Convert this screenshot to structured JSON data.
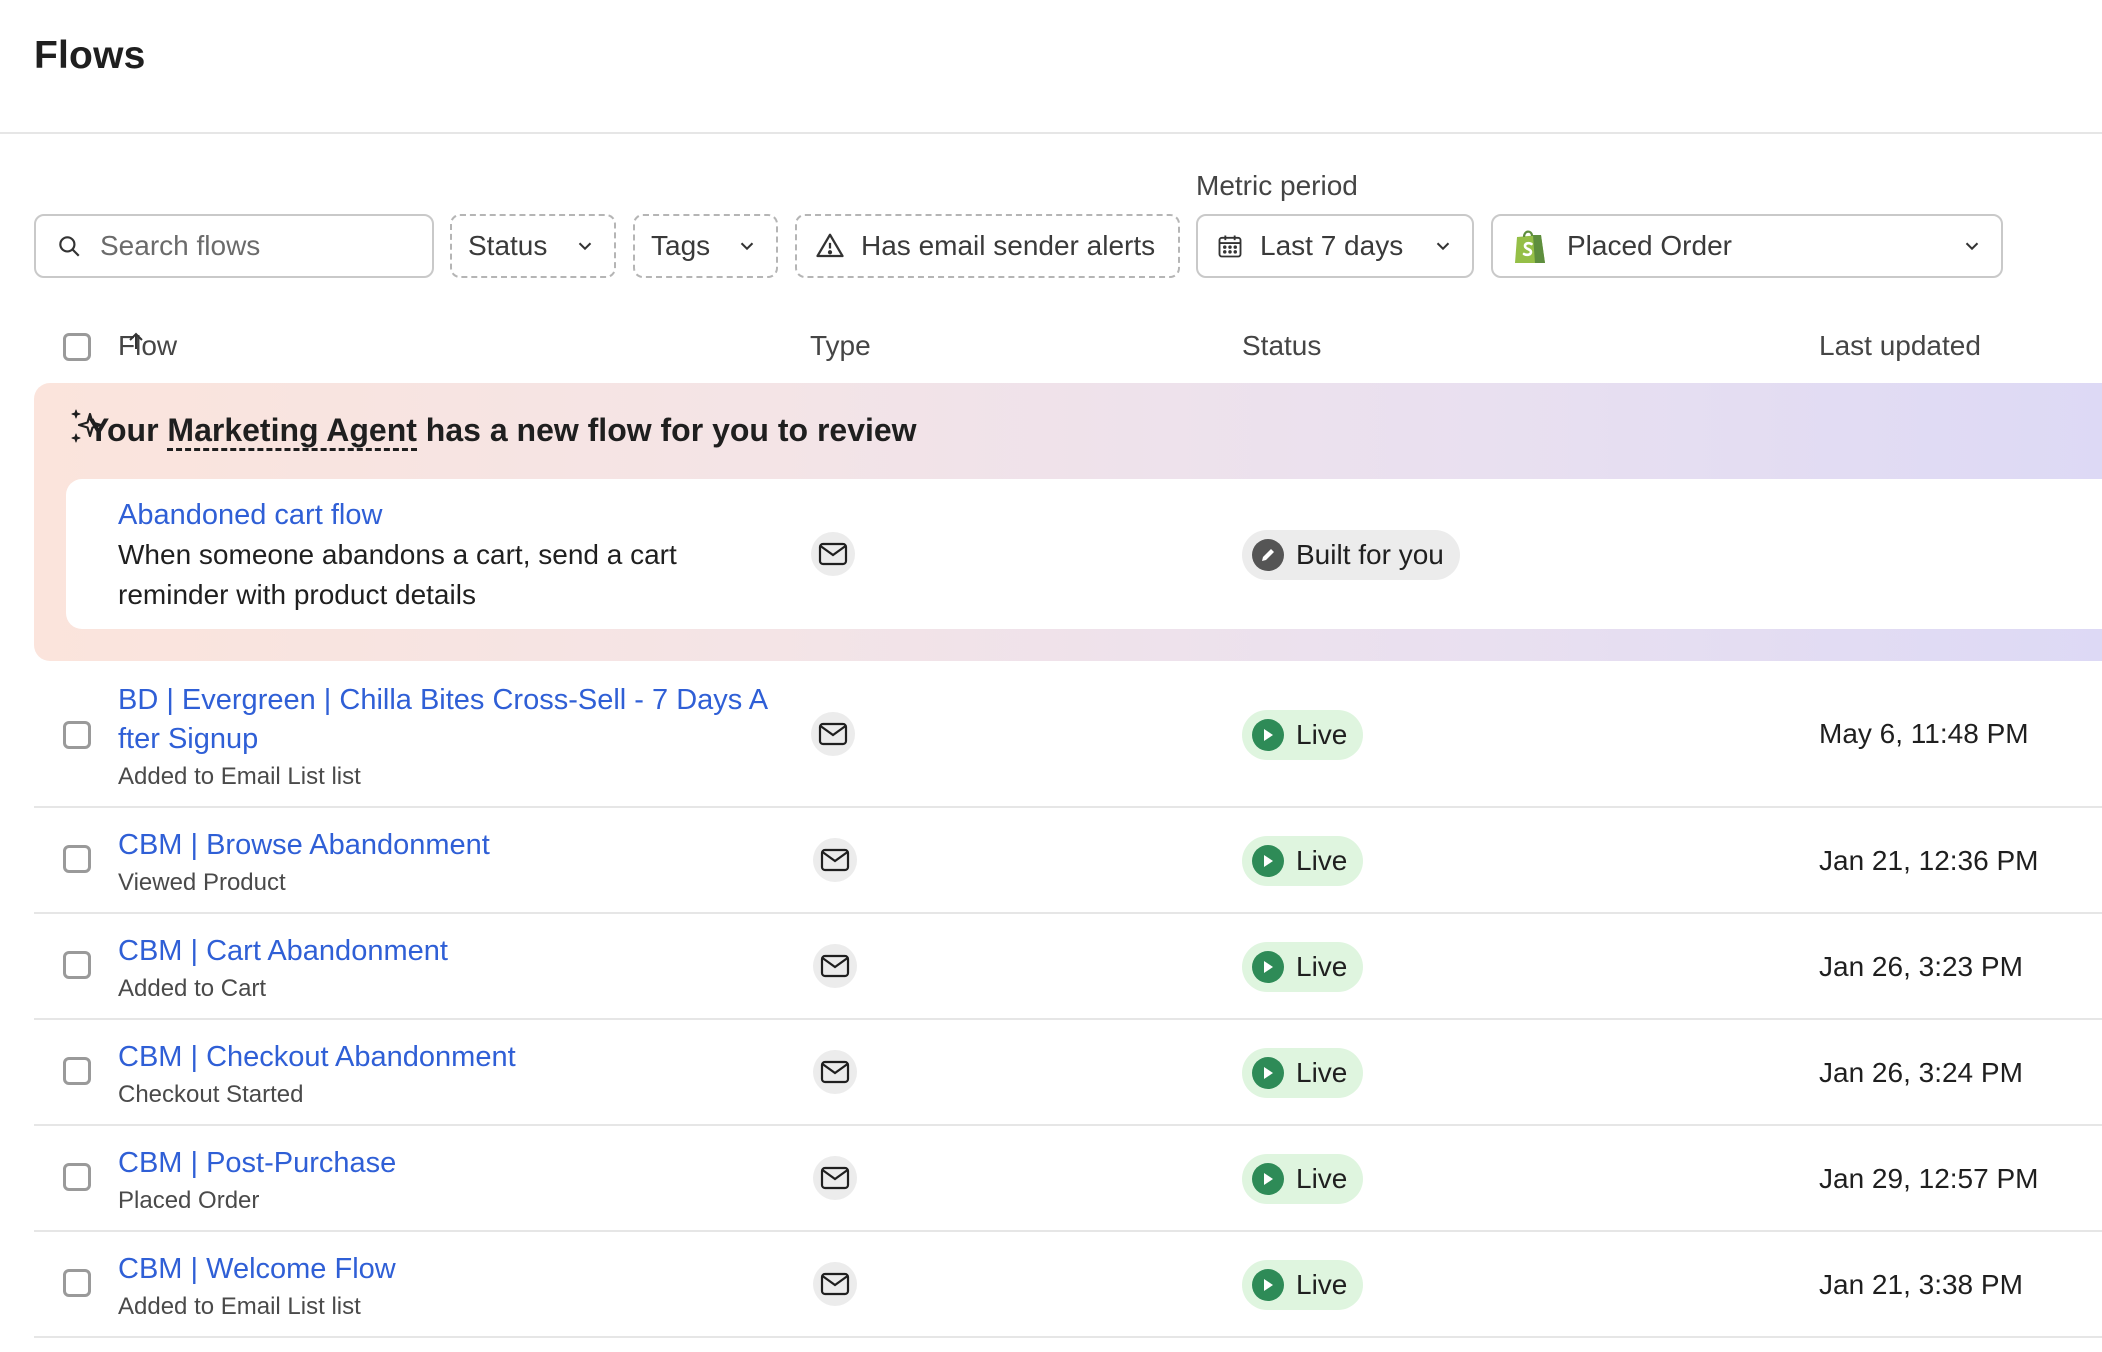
{
  "page": {
    "title": "Flows"
  },
  "filters": {
    "search_placeholder": "Search flows",
    "status_label": "Status",
    "tags_label": "Tags",
    "alerts_label": "Has email sender alerts",
    "metric_period_label": "Metric period",
    "period_value": "Last 7 days",
    "metric_value": "Placed Order"
  },
  "table": {
    "columns": {
      "flow": "Flow",
      "type": "Type",
      "status": "Status",
      "last_updated": "Last updated"
    }
  },
  "agent": {
    "headline_prefix": "Your ",
    "headline_link": "Marketing Agent",
    "headline_suffix": " has a new flow for you to review",
    "flow_name": "Abandoned cart flow",
    "flow_description_line1": "When someone abandons a cart, send a cart",
    "flow_description_line2": "reminder with product details",
    "badge": "Built for you"
  },
  "flows": [
    {
      "name_line1": "BD | Evergreen | Chilla Bites Cross-Sell - 7 Days A",
      "name_line2": "fter Signup",
      "trigger": "Added to Email List list",
      "status": "Live",
      "updated": "May 6, 11:48 PM"
    },
    {
      "name": "CBM | Browse Abandonment",
      "trigger": "Viewed Product",
      "status": "Live",
      "updated": "Jan 21, 12:36 PM"
    },
    {
      "name": "CBM | Cart Abandonment",
      "trigger": "Added to Cart",
      "status": "Live",
      "updated": "Jan 26, 3:23 PM"
    },
    {
      "name": "CBM | Checkout Abandonment",
      "trigger": "Checkout Started",
      "status": "Live",
      "updated": "Jan 26, 3:24 PM"
    },
    {
      "name": "CBM | Post-Purchase",
      "trigger": "Placed Order",
      "status": "Live",
      "updated": "Jan 29, 12:57 PM"
    },
    {
      "name": "CBM | Welcome Flow",
      "trigger": "Added to Email List list",
      "status": "Live",
      "updated": "Jan 21, 3:38 PM"
    }
  ],
  "icons": {
    "search": "search-icon",
    "chevron": "chevron-down-icon",
    "warning": "warning-triangle-icon",
    "calendar": "calendar-icon",
    "shopify": "shopify-bag-icon",
    "sparkle": "sparkle-icon",
    "mail": "mail-icon",
    "play": "play-icon",
    "pencil": "pencil-icon",
    "sort": "sort-ascending-icon"
  },
  "colors": {
    "link": "#2f5fd6",
    "live_bg": "#dff5df",
    "live_icon": "#2e8b57",
    "shopify": "#95bf47"
  }
}
